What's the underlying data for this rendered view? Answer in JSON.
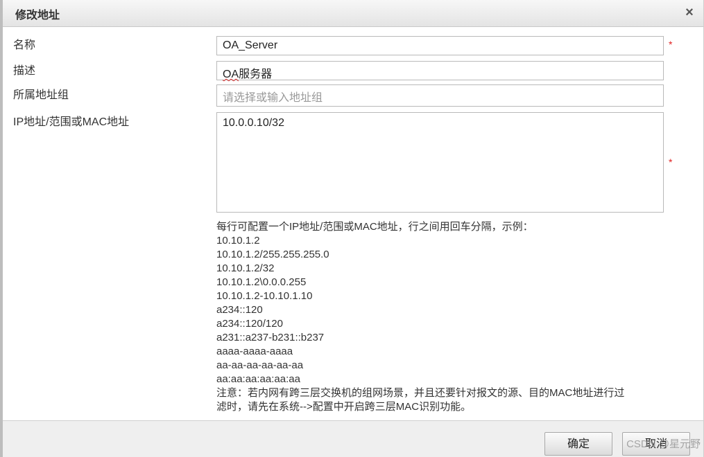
{
  "dialog": {
    "title": "修改地址",
    "close_glyph": "×"
  },
  "form": {
    "name_label": "名称",
    "name_value": "OA_Server",
    "desc_label": "描述",
    "desc_value_prefix": "OA",
    "desc_value_suffix": "服务器",
    "group_label": "所属地址组",
    "group_placeholder": "请选择或输入地址组",
    "ip_label": "IP地址/范围或MAC地址",
    "ip_value": "10.0.0.10/32",
    "required_mark": "*"
  },
  "help": {
    "intro": "每行可配置一个IP地址/范围或MAC地址，行之间用回车分隔，示例：",
    "examples": [
      "10.10.1.2",
      "10.10.1.2/255.255.255.0",
      "10.10.1.2/32",
      "10.10.1.2\\0.0.0.255",
      "10.10.1.2-10.10.1.10",
      "a234::120",
      "a234::120/120",
      "a231::a237-b231::b237",
      "aaaa-aaaa-aaaa",
      "aa-aa-aa-aa-aa-aa",
      "aa:aa:aa:aa:aa:aa"
    ],
    "note_line1": "注意：若内网有跨三层交换机的组网场景，并且还要针对报文的源、目的MAC地址进行过",
    "note_line2": "滤时，请先在系统-->配置中开启跨三层MAC识别功能。"
  },
  "footer": {
    "ok_label": "确定",
    "cancel_label": "取消"
  },
  "watermark": "CSDN @星元野"
}
